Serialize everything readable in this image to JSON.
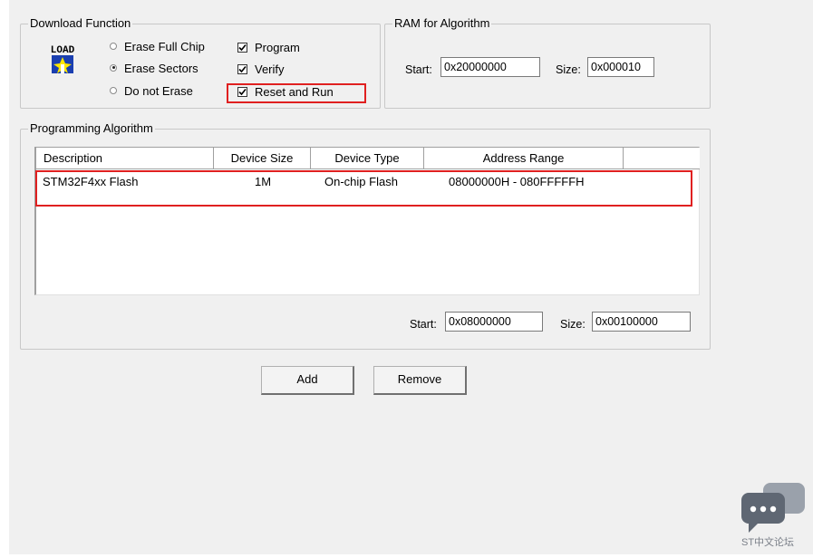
{
  "download_function": {
    "title": "Download Function",
    "load_icon_text": "LOAD",
    "erase_full_chip": "Erase Full Chip",
    "erase_sectors": "Erase Sectors",
    "do_not_erase": "Do not Erase",
    "program": "Program",
    "verify": "Verify",
    "reset_and_run": "Reset and Run",
    "selected_erase": "Erase Sectors",
    "checked": [
      "Program",
      "Verify",
      "Reset and Run"
    ]
  },
  "ram_for_algorithm": {
    "title": "RAM for Algorithm",
    "start_label": "Start:",
    "start_value": "0x20000000",
    "size_label": "Size:",
    "size_value": "0x000010"
  },
  "programming_algorithm": {
    "title": "Programming Algorithm",
    "columns": [
      "Description",
      "Device Size",
      "Device Type",
      "Address Range"
    ],
    "rows": [
      {
        "description": "STM32F4xx Flash",
        "device_size": "1M",
        "device_type": "On-chip Flash",
        "address_range": "08000000H - 080FFFFFH"
      }
    ],
    "start_label": "Start:",
    "start_value": "0x08000000",
    "size_label": "Size:",
    "size_value": "0x00100000"
  },
  "buttons": {
    "add": "Add",
    "remove": "Remove"
  },
  "watermark": {
    "text": "ST中文论坛"
  },
  "colors": {
    "highlight_box": "#e02020",
    "dialog_bg": "#f0f0f0",
    "watermark_icon": "#6d7480"
  }
}
